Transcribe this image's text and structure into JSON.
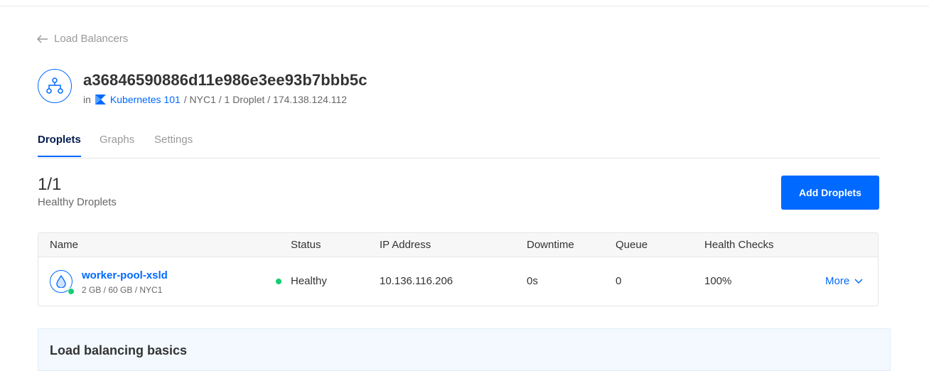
{
  "nav": {
    "back_label": "Load Balancers"
  },
  "header": {
    "title": "a36846590886d11e986e3ee93b7bbb5c",
    "meta_prefix": "in",
    "project_name": "Kubernetes 101",
    "meta_rest": "/ NYC1 / 1 Droplet / 174.138.124.112"
  },
  "tabs": [
    {
      "label": "Droplets",
      "active": true
    },
    {
      "label": "Graphs",
      "active": false
    },
    {
      "label": "Settings",
      "active": false
    }
  ],
  "summary": {
    "count": "1/1",
    "label": "Healthy Droplets"
  },
  "add_button_label": "Add Droplets",
  "table": {
    "headers": [
      "Name",
      "Status",
      "IP Address",
      "Downtime",
      "Queue",
      "Health Checks"
    ],
    "rows": [
      {
        "name": "worker-pool-xsld",
        "specs": "2 GB / 60 GB / NYC1",
        "status": "Healthy",
        "ip": "10.136.116.206",
        "downtime": "0s",
        "queue": "0",
        "health": "100%",
        "action": "More"
      }
    ]
  },
  "basics": {
    "title": "Load balancing basics"
  },
  "colors": {
    "accent": "#0069ff",
    "healthy": "#15cd72",
    "text": "#333333",
    "muted": "#999999"
  },
  "icons": [
    "arrow-left-icon",
    "load-balancer-icon",
    "project-icon",
    "droplet-icon",
    "chevron-down-icon"
  ]
}
